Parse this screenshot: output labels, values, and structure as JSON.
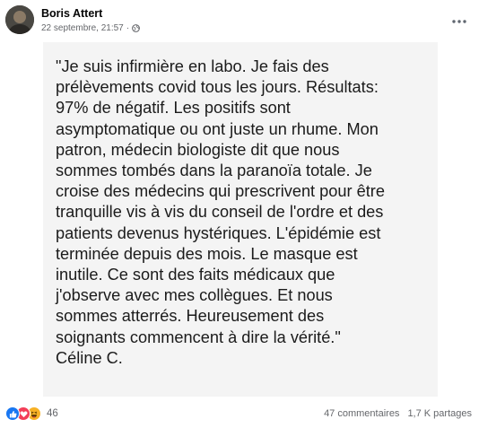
{
  "post": {
    "author": "Boris Attert",
    "timestamp": "22 septembre, 21:57",
    "separator": "·",
    "privacy_icon": "globe-icon",
    "more_icon": "more-options-icon"
  },
  "image_text": "\"Je suis infirmière en labo. Je fais des\nprélèvements covid tous les jours. Résultats:\n97% de négatif. Les positifs sont\nasymptomatique ou ont juste un rhume. Mon\npatron, médecin biologiste dit que nous\nsommes tombés dans la paranoïa totale. Je\ncroise des médecins qui prescrivent pour être\ntranquille vis à vis du conseil de l'ordre et des\npatients devenus hystériques. L'épidémie est\nterminée depuis des mois. Le masque est\ninutile. Ce sont des faits médicaux que\nj'observe avec mes collègues. Et nous\nsommes atterrés. Heureusement des\nsoignants commencent à dire la vérité.\"\nCéline C.",
  "footer": {
    "reactions": [
      "like-icon",
      "love-icon",
      "haha-icon"
    ],
    "reaction_count": "46",
    "comments": "47 commentaires",
    "shares": "1,7 K partages"
  },
  "colors": {
    "like": "#1877f2",
    "love": "#f33e58",
    "haha": "#f7b125",
    "panel_bg": "#f4f4f4",
    "meta_text": "#65676b"
  }
}
